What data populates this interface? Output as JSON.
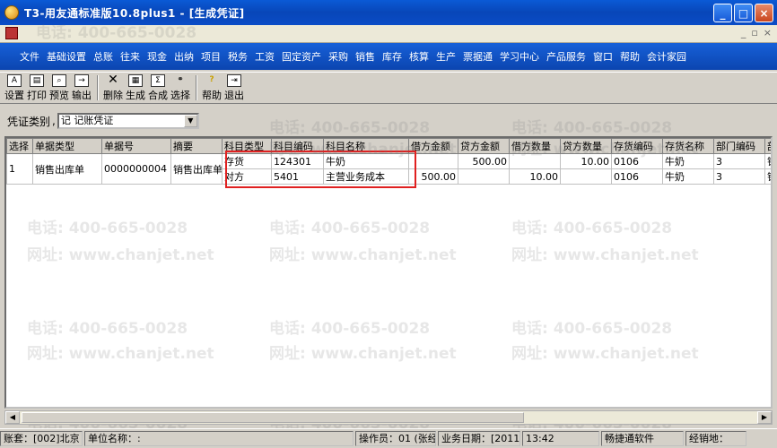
{
  "window": {
    "title": "T3-用友通标准版10.8plus1 - [生成凭证]",
    "minimize_icon": "minimize-icon",
    "maximize_icon": "maximize-icon",
    "close_icon": "close-icon"
  },
  "menubar": {
    "items": [
      "文件",
      "基础设置",
      "总账",
      "往来",
      "现金",
      "出纳",
      "项目",
      "税务",
      "工资",
      "固定资产",
      "采购",
      "销售",
      "库存",
      "核算",
      "生产",
      "票据通",
      "学习中心",
      "产品服务",
      "窗口",
      "帮助",
      "会计家园"
    ]
  },
  "toolbar": {
    "buttons": [
      {
        "label": "设置",
        "icon": "settings-icon"
      },
      {
        "label": "打印",
        "icon": "printer-icon"
      },
      {
        "label": "预览",
        "icon": "preview-icon"
      },
      {
        "label": "输出",
        "icon": "export-icon"
      },
      {
        "label": "删除",
        "icon": "delete-icon"
      },
      {
        "label": "生成",
        "icon": "generate-icon"
      },
      {
        "label": "合成",
        "icon": "merge-icon"
      },
      {
        "label": "选择",
        "icon": "binoculars-icon"
      },
      {
        "label": "帮助",
        "icon": "help-icon"
      },
      {
        "label": "退出",
        "icon": "exit-icon"
      }
    ]
  },
  "filter": {
    "label": "凭证类别",
    "value": "记 记账凭证"
  },
  "grid": {
    "columns": [
      "选择",
      "单据类型",
      "单据号",
      "摘要",
      "科目类型",
      "科目编码",
      "科目名称",
      "借方金额",
      "贷方金额",
      "借方数量",
      "贷方数量",
      "存货编码",
      "存货名称",
      "部门编码",
      "部"
    ],
    "row": {
      "select": "1",
      "doc_type": "销售出库单",
      "doc_no": "0000000004",
      "summary": "销售出库单",
      "lines": [
        {
          "subject_type": "存货",
          "subject_code": "124301",
          "subject_name": "牛奶",
          "debit": "",
          "credit": "500.00",
          "debit_qty": "",
          "credit_qty": "10.00",
          "inv_code": "0106",
          "inv_name": "牛奶",
          "dept_code": "3",
          "extra": "销"
        },
        {
          "subject_type": "对方",
          "subject_code": "5401",
          "subject_name": "主营业务成本",
          "debit": "500.00",
          "credit": "",
          "debit_qty": "10.00",
          "credit_qty": "",
          "inv_code": "0106",
          "inv_name": "牛奶",
          "dept_code": "3",
          "extra": "销"
        }
      ]
    }
  },
  "statusbar": {
    "account": "账套：[002]北京",
    "unit": "单位名称：:",
    "operator": "操作员：01 (张经",
    "business_date": "业务日期：[2011",
    "time": "13:42",
    "vendor": "畅捷通软件",
    "sales": "经销地："
  },
  "watermark": {
    "phone": "电话: 400-665-0028",
    "site": "网址: www.chanjet.net"
  }
}
